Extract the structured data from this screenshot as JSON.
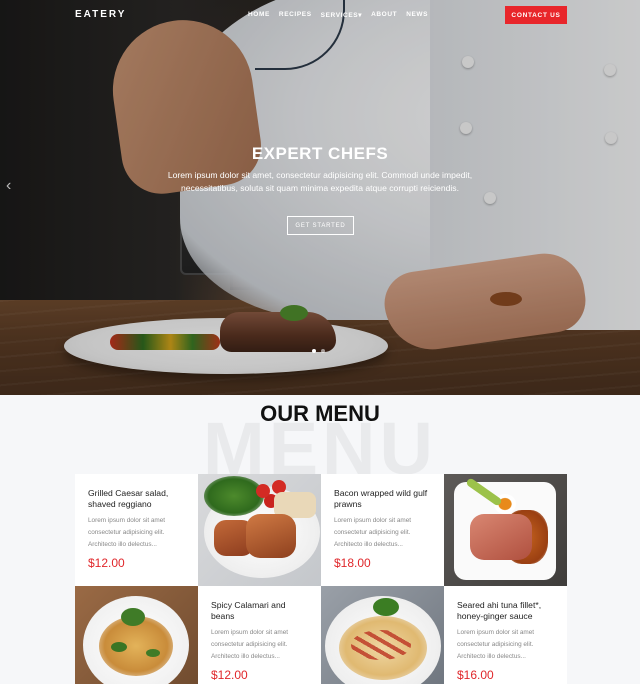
{
  "nav": {
    "brand": "EATERY",
    "links": [
      "HOME",
      "RECIPES",
      "SERVICES",
      "ABOUT",
      "NEWS"
    ],
    "services_caret": "▾",
    "contact_label": "CONTACT US"
  },
  "hero": {
    "title": "EXPERT CHEFS",
    "text": "Lorem ipsum dolor sit amet, consectetur adipisicing elit. Commodi unde impedit, necessitatibus, soluta sit quam minima expedita atque corrupti reiciendis.",
    "cta_label": "GET STARTED",
    "prev_arrow": "‹",
    "slide_count": 2,
    "active_slide": 1
  },
  "menu_section": {
    "title": "OUR MENU",
    "background_word": "MENU",
    "items": [
      {
        "name": "Grilled Caesar salad, shaved reggiano",
        "desc": "Lorem ipsum dolor sit amet consectetur adipisicing elit. Architecto illo delectus...",
        "price": "$12.00"
      },
      {
        "name": "Bacon wrapped wild gulf prawns",
        "desc": "Lorem ipsum dolor sit amet consectetur adipisicing elit. Architecto illo delectus...",
        "price": "$18.00"
      },
      {
        "name": "Spicy Calamari and beans",
        "desc": "Lorem ipsum dolor sit amet consectetur adipisicing elit. Architecto illo delectus...",
        "price": "$12.00"
      },
      {
        "name": "Seared ahi tuna fillet*, honey-ginger sauce",
        "desc": "Lorem ipsum dolor sit amet consectetur adipisicing elit. Architecto illo delectus...",
        "price": "$16.00"
      }
    ]
  },
  "colors": {
    "accent": "#e8262b",
    "price": "#e0272b"
  }
}
